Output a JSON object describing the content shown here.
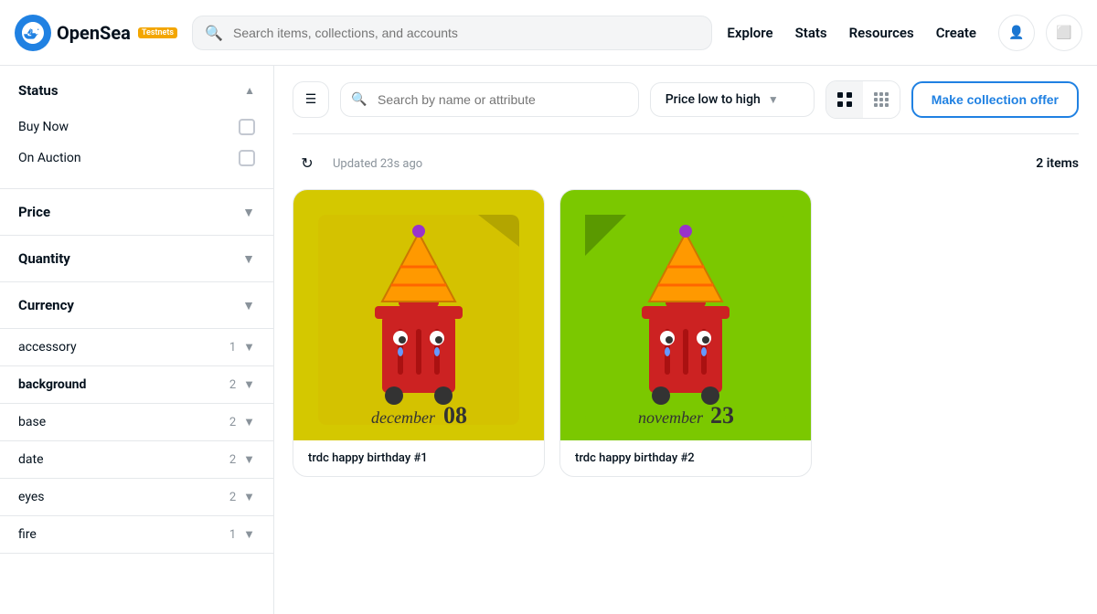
{
  "navbar": {
    "logo_text": "OpenSea",
    "logo_badge": "Testnets",
    "search_placeholder": "Search items, collections, and accounts",
    "nav_links": [
      "Explore",
      "Stats",
      "Resources",
      "Create"
    ]
  },
  "toolbar": {
    "search_placeholder": "Search by name or attribute",
    "sort_label": "Price low to high",
    "make_offer_label": "Make collection offer"
  },
  "results": {
    "updated_text": "Updated 23s ago",
    "items_count": "2 items"
  },
  "sidebar": {
    "status_section": {
      "label": "Status",
      "options": [
        {
          "label": "Buy Now",
          "checked": false
        },
        {
          "label": "On Auction",
          "checked": false
        }
      ]
    },
    "filter_sections": [
      {
        "label": "Price"
      },
      {
        "label": "Quantity"
      },
      {
        "label": "Currency"
      }
    ],
    "attributes": [
      {
        "label": "accessory",
        "count": 1
      },
      {
        "label": "background",
        "count": 2
      },
      {
        "label": "base",
        "count": 2
      },
      {
        "label": "date",
        "count": 2
      },
      {
        "label": "eyes",
        "count": 2
      },
      {
        "label": "fire",
        "count": 1
      }
    ]
  },
  "nfts": [
    {
      "id": 1,
      "name": "trdc happy birthday #1",
      "bg_color": "#d4c800",
      "month": "december",
      "day": "08"
    },
    {
      "id": 2,
      "name": "trdc happy birthday #2",
      "bg_color": "#7bc800",
      "month": "november",
      "day": "23"
    }
  ]
}
